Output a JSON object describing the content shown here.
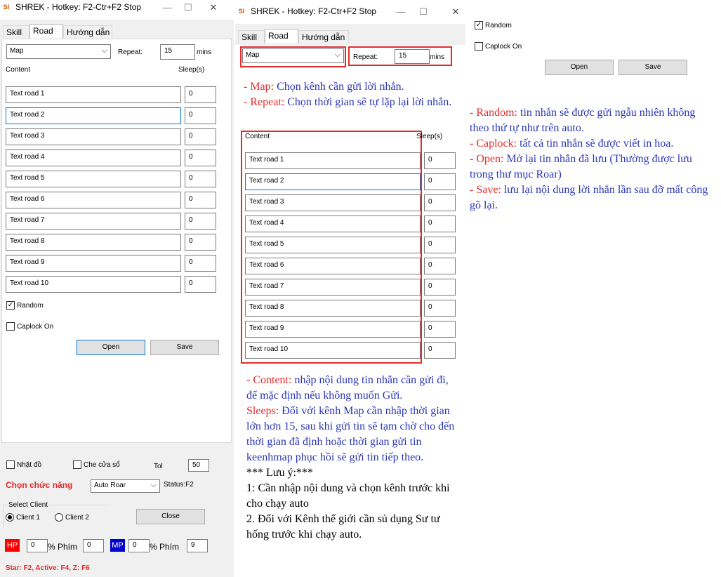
{
  "window": {
    "title": "SHREK - Hotkey: F2-Ctr+F2 Stop",
    "icon_text": "SI",
    "minimize": "—",
    "maximize": "☐",
    "close": "✕"
  },
  "tabs": [
    "Skill",
    "Road",
    "Hướng dẫn"
  ],
  "form": {
    "map_value": "Map",
    "repeat_label": "Repeat:",
    "repeat_value": "15",
    "mins_label": "mins",
    "content_header": "Content",
    "sleep_header": "Sleep(s)",
    "rows": [
      {
        "text": "Text road 1",
        "sleep": "0"
      },
      {
        "text": "Text road 2",
        "sleep": "0"
      },
      {
        "text": "Text road 3",
        "sleep": "0"
      },
      {
        "text": "Text road 4",
        "sleep": "0"
      },
      {
        "text": "Text road 5",
        "sleep": "0"
      },
      {
        "text": "Text road 6",
        "sleep": "0"
      },
      {
        "text": "Text road 7",
        "sleep": "0"
      },
      {
        "text": "Text road 8",
        "sleep": "0"
      },
      {
        "text": "Text road 9",
        "sleep": "0"
      },
      {
        "text": "Text road 10",
        "sleep": "0"
      }
    ],
    "random_label": "Random",
    "random_checked": true,
    "caplock_label": "Caplock On",
    "caplock_checked": false,
    "open_label": "Open",
    "save_label": "Save"
  },
  "bottom": {
    "nhat_do_label": "Nhặt đồ",
    "che_cua_so_label": "Che cửa sổ",
    "tol_label": "Tol",
    "tol_value": "50",
    "chon_chuc_nang_label": "Chọn chức năng",
    "function_value": "Auto Roar",
    "status_label": "Status:F2",
    "select_client_label": "Select Client",
    "client1_label": "Client 1",
    "client2_label": "Client 2",
    "close_label": "Close",
    "hp_label": "HP",
    "hp_value": "0",
    "hp_key_label": "% Phím",
    "hp_key_value": "0",
    "mp_label": "MP",
    "mp_value": "0",
    "mp_key_label": "% Phím",
    "mp_key_value": "9",
    "hotkeys_text": "Star: F2, Active: F4, Z: F6"
  },
  "notes": {
    "map_key": "- Map:",
    "map_text": " Chọn kênh cần gửi lời nhắn.",
    "repeat_key": "- Repeat:",
    "repeat_text": " Chọn thời gian sẽ tự lặp lại lời nhắn.",
    "content_key": "- Content:",
    "content_text": " nhập nội dung tin nhắn cần gửi đi, để mặc định nếu không muốn Gửi.",
    "sleeps_key": "Sleeps:",
    "sleeps_text": " Đối với kênh Map cần nhập thời gian lớn hơn 15, sau khi gửi tin sẽ tạm chờ cho đến thời gian đã định hoặc thời gian gửi tin keenhmap phục hồi sẽ gửi tin tiếp theo.",
    "luu_y": "*** Lưu ý:***",
    "luu_y_1": "1: Cần nhập nội dung và chọn kênh trước khi cho chạy auto",
    "luu_y_2": "2. Đối với Kênh thế giới cần sủ dụng Sư tư hống trước khi chạy auto.",
    "random_key": "- Random:",
    "random_text": " tin nhắn sẽ được gửi ngẫu nhiên không theo thứ tự như trên auto.",
    "caplock_key": "- Caplock:",
    "caplock_text": " tất cả tin nhắn sẽ được viết in hoa.",
    "open_key": "- Open:",
    "open_text": " Mở lại tin nhắn đã lưu (Thường được lưu trong thư mục Roar)",
    "save_key": "- Save:",
    "save_text": " lưu lại nội dung lời nhắn lần sau đỡ mất công gõ lại."
  },
  "colors": {
    "accent_red": "#e32b2b",
    "note_blue": "#2b36b5",
    "hp_red": "#ff0000",
    "mp_blue": "#0000cc"
  }
}
